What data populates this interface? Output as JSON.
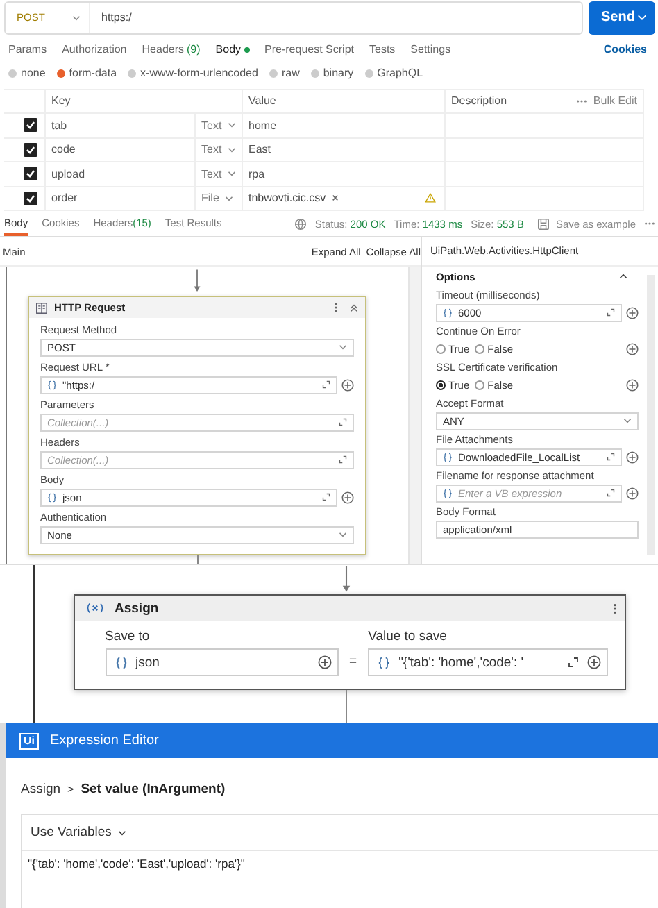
{
  "request": {
    "method": "POST",
    "url": "https:/",
    "send_label": "Send"
  },
  "request_tabs": [
    {
      "label": "Params",
      "selected": false,
      "dot": false
    },
    {
      "label": "Authorization",
      "selected": false,
      "dot": false
    },
    {
      "label": "Headers",
      "count": "(9)",
      "selected": false,
      "dot": false
    },
    {
      "label": "Body",
      "selected": true,
      "dot": true
    },
    {
      "label": "Pre-request Script",
      "selected": false,
      "dot": false
    },
    {
      "label": "Tests",
      "selected": false,
      "dot": false
    },
    {
      "label": "Settings",
      "selected": false,
      "dot": false
    }
  ],
  "cookies_link": "Cookies",
  "body_types": [
    {
      "label": "none",
      "selected": false
    },
    {
      "label": "form-data",
      "selected": true
    },
    {
      "label": "x-www-form-urlencoded",
      "selected": false
    },
    {
      "label": "raw",
      "selected": false
    },
    {
      "label": "binary",
      "selected": false
    },
    {
      "label": "GraphQL",
      "selected": false
    }
  ],
  "form_table": {
    "columns": [
      "Key",
      "Value",
      "Description"
    ],
    "bulk_edit": "Bulk Edit",
    "rows": [
      {
        "checked": true,
        "key": "tab",
        "type": "Text",
        "value": "home",
        "kind": "text"
      },
      {
        "checked": true,
        "key": "code",
        "type": "Text",
        "value": "East",
        "kind": "text"
      },
      {
        "checked": true,
        "key": "upload",
        "type": "Text",
        "value": "rpa",
        "kind": "text"
      },
      {
        "checked": true,
        "key": "order",
        "type": "File",
        "value": "tnbwovti.cic.csv",
        "kind": "file"
      }
    ]
  },
  "response": {
    "tabs": [
      {
        "label": "Body",
        "selected": true
      },
      {
        "label": "Cookies",
        "selected": false
      },
      {
        "label": "Headers",
        "count": "(15)",
        "selected": false
      },
      {
        "label": "Test Results",
        "selected": false
      }
    ],
    "stats": [
      {
        "label": "Status:",
        "value": "200 OK"
      },
      {
        "label": "Time:",
        "value": "1433 ms"
      },
      {
        "label": "Size:",
        "value": "553 B"
      }
    ],
    "save_label": "Save as example"
  },
  "designer": {
    "breadcrumb": "Main",
    "expand_all": "Expand All",
    "collapse_all": "Collapse All"
  },
  "http_request": {
    "title": "HTTP Request",
    "fields": [
      {
        "label": "Request Method",
        "kind": "select",
        "value": "POST"
      },
      {
        "label": "Request URL *",
        "kind": "expression",
        "value": "\"https:/"
      },
      {
        "label": "Parameters",
        "kind": "collection",
        "placeholder": "Collection(...)"
      },
      {
        "label": "Headers",
        "kind": "collection",
        "placeholder": "Collection(...)"
      },
      {
        "label": "Body",
        "kind": "expression",
        "value": "json"
      },
      {
        "label": "Authentication",
        "kind": "select",
        "value": "None"
      }
    ]
  },
  "properties": {
    "title": "UiPath.Web.Activities.HttpClient",
    "section": "Options",
    "fields": [
      {
        "label": "Timeout (milliseconds)",
        "kind": "expression",
        "value": "6000"
      },
      {
        "label": "Continue On Error",
        "kind": "radio",
        "options": [
          {
            "label": "True",
            "selected": false
          },
          {
            "label": "False",
            "selected": false
          }
        ]
      },
      {
        "label": "SSL Certificate verification",
        "kind": "radio",
        "options": [
          {
            "label": "True",
            "selected": true
          },
          {
            "label": "False",
            "selected": false
          }
        ]
      },
      {
        "label": "Accept Format",
        "kind": "select",
        "value": "ANY"
      },
      {
        "label": "File Attachments",
        "kind": "expression",
        "value": "DownloadedFile_LocalList"
      },
      {
        "label": "Filename for response attachment",
        "kind": "expression",
        "placeholder": "Enter a VB expression"
      },
      {
        "label": "Body Format",
        "kind": "text",
        "value": "application/xml"
      }
    ]
  },
  "assign": {
    "title": "Assign",
    "save_to_label": "Save to",
    "value_label": "Value to save",
    "save_to": "json",
    "equals": "=",
    "value": "\"{'tab': 'home','code': '"
  },
  "expression_editor": {
    "logo": "Ui",
    "title": "Expression Editor",
    "breadcrumb": [
      "Assign",
      "Set value (InArgument)"
    ],
    "separator": ">",
    "use_variables": "Use Variables",
    "expression": "\"{'tab': 'home','code': 'East','upload': 'rpa'}\""
  }
}
